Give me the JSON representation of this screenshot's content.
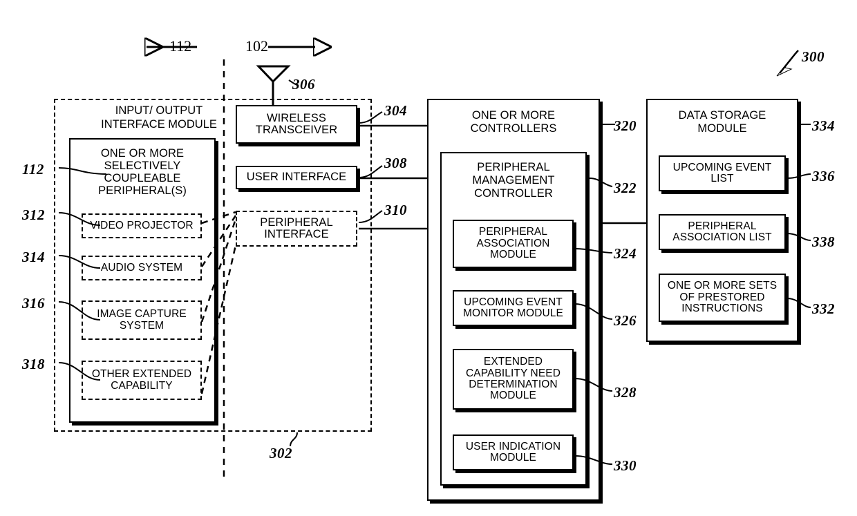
{
  "figure": {
    "figure_ref": "300",
    "device_ref": "302",
    "left_arrow_caption": "112",
    "right_arrow_caption": "102"
  },
  "left_region": {
    "title": "INPUT/ OUTPUT\nINTERFACE MODULE",
    "title_line1": "INPUT/ OUTPUT",
    "title_line2": "INTERFACE MODULE",
    "ref": "112",
    "peripherals_box": {
      "title_line1": "ONE OR MORE",
      "title_line2": "SELECTIVELY",
      "title_line3": "COUPLEABLE",
      "title_line4": "PERIPHERAL(S)",
      "items": [
        {
          "label": "VIDEO PROJECTOR",
          "ref": "312"
        },
        {
          "label": "AUDIO SYSTEM",
          "ref": "314"
        },
        {
          "label": "IMAGE CAPTURE\nSYSTEM",
          "ref": "316"
        },
        {
          "label": "OTHER EXTENDED\nCAPABILITY",
          "ref": "318"
        }
      ]
    }
  },
  "interfaces": {
    "antenna_ref": "306",
    "items": [
      {
        "label": "WIRELESS\nTRANSCEIVER",
        "ref": "304",
        "style": "solid"
      },
      {
        "label": "USER INTERFACE",
        "ref": "308",
        "style": "solid"
      },
      {
        "label": "PERIPHERAL\nINTERFACE",
        "ref": "310",
        "style": "dashed"
      }
    ]
  },
  "controllers": {
    "title_line1": "ONE OR MORE",
    "title_line2": "CONTROLLERS",
    "ref": "320",
    "management_controller": {
      "title_line1": "PERIPHERAL",
      "title_line2": "MANAGEMENT",
      "title_line3": "CONTROLLER",
      "ref": "322",
      "modules": [
        {
          "label": "PERIPHERAL\nASSOCIATION\nMODULE",
          "ref": "324"
        },
        {
          "label": "UPCOMING EVENT\nMONITOR MODULE",
          "ref": "326"
        },
        {
          "label": "EXTENDED\nCAPABILITY NEED\nDETERMINATION\nMODULE",
          "ref": "328"
        },
        {
          "label": "USER INDICATION\nMODULE",
          "ref": "330"
        }
      ]
    }
  },
  "data_storage": {
    "title_line1": "DATA STORAGE",
    "title_line2": "MODULE",
    "ref": "334",
    "items": [
      {
        "label": "UPCOMING EVENT\nLIST",
        "ref": "336"
      },
      {
        "label": "PERIPHERAL\nASSOCIATION LIST",
        "ref": "338"
      },
      {
        "label": "ONE OR MORE SETS\nOF PRESTORED\nINSTRUCTIONS",
        "ref": "332"
      }
    ]
  }
}
